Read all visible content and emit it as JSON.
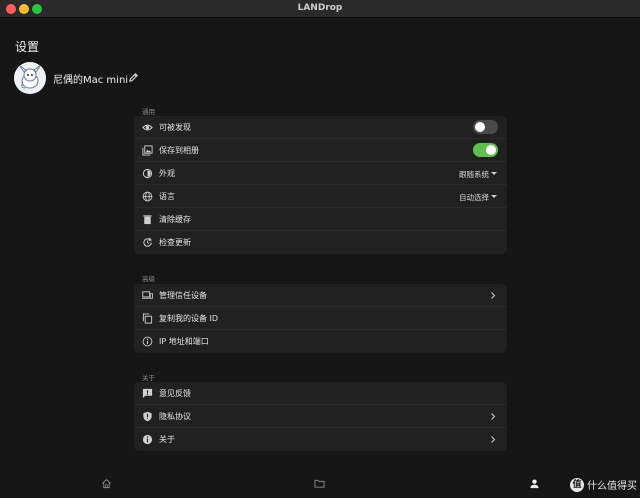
{
  "window": {
    "title": "LANDrop"
  },
  "page": {
    "title": "设置"
  },
  "device": {
    "name": "尼偶的Mac mini"
  },
  "sections": {
    "general": {
      "label": "通用",
      "discoverable": {
        "label": "可被发现",
        "on": false
      },
      "save_album": {
        "label": "保存到相册",
        "on": true
      },
      "appearance": {
        "label": "外观",
        "value": "跟随系统"
      },
      "language": {
        "label": "语言",
        "value": "自动选择"
      },
      "clear_cache": {
        "label": "清除缓存"
      },
      "check_update": {
        "label": "检查更新"
      }
    },
    "advanced": {
      "label": "高级",
      "trusted_devices": {
        "label": "管理信任设备"
      },
      "copy_id": {
        "label": "复制我的设备 ID"
      },
      "ip_port": {
        "label": "IP 地址和端口"
      }
    },
    "about": {
      "label": "关于",
      "feedback": {
        "label": "意见反馈"
      },
      "privacy": {
        "label": "隐私协议"
      },
      "about": {
        "label": "关于"
      }
    }
  },
  "bottom_nav": {
    "items": [
      "home-icon",
      "folder-icon",
      "person-icon"
    ]
  },
  "watermark": {
    "badge": "值",
    "text": "什么值得买"
  },
  "colors": {
    "toggle_on": "#5cbf4f",
    "toggle_off": "#4a4a4a",
    "card": "#212121",
    "background": "#161616"
  }
}
